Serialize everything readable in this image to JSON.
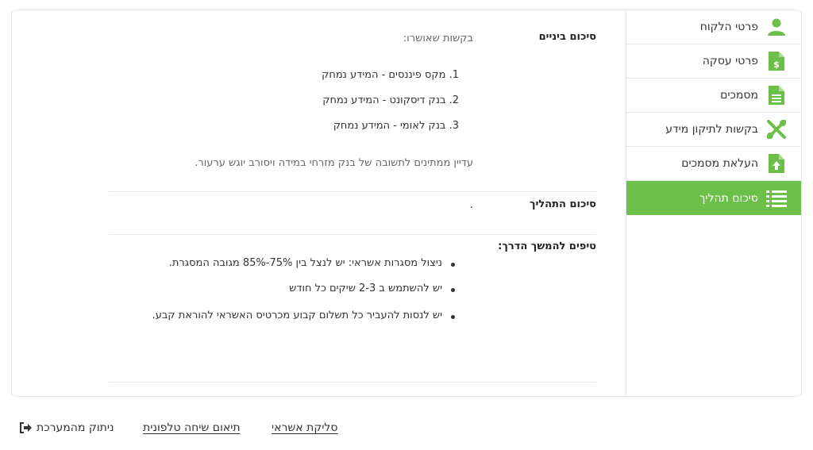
{
  "sidebar": {
    "items": [
      {
        "label": "פרטי הלקוח",
        "icon": "user-icon"
      },
      {
        "label": "פרטי עסקה",
        "icon": "invoice-icon"
      },
      {
        "label": "מסמכים",
        "icon": "document-icon"
      },
      {
        "label": "בקשות לתיקון מידע",
        "icon": "tools-icon"
      },
      {
        "label": "העלאת מסמכים",
        "icon": "upload-file-icon"
      },
      {
        "label": "סיכום תהליך",
        "icon": "list-icon"
      }
    ],
    "active_index": 5,
    "accent_color": "#6cc04a"
  },
  "interim": {
    "title": "סיכום ביניים",
    "approved_label": "בקשות שאושרו:",
    "items": [
      "1. מקס פיננסים - המידע נמחק",
      "2. בנק דיסקונט - המידע נמחק",
      "3. בנק לאומי - המידע נמחק"
    ],
    "waiting_note": "עדיין ממתינים לתשובה של בנק מזרחי במידה ויסורב יוגש ערעור."
  },
  "process": {
    "title": "סיכום התהליך",
    "value": "."
  },
  "tips": {
    "title": "טיפים להמשך הדרך:",
    "items": [
      "ניצול מסגרות אשראי: יש לנצל בין 75%-85% מגובה המסגרת.",
      "יש להשתמש ב 2-3 שיקים כל חודש",
      "יש לנסות להעביר כל תשלום קבוע מכרטיס האשראי להוראת קבע."
    ]
  },
  "footer": {
    "credit_clearing": "סליקת אשראי",
    "schedule_call": "תיאום שיחה טלפונית",
    "logout": "ניתוק מהמערכת"
  }
}
